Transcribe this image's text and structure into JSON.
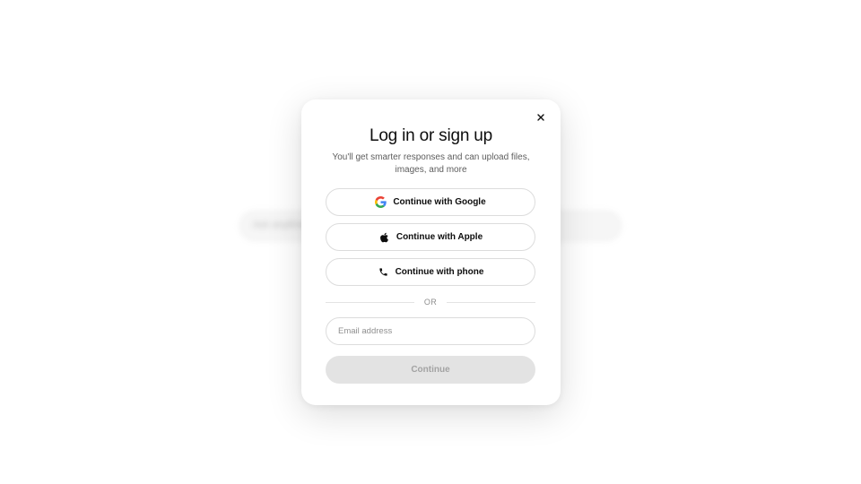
{
  "background": {
    "search_placeholder": "Ask anything"
  },
  "modal": {
    "close_icon": "close-icon",
    "title": "Log in or sign up",
    "subtitle": "You'll get smarter responses and can upload files, images, and more",
    "buttons": {
      "google": {
        "label": "Continue with Google",
        "icon": "google-icon"
      },
      "apple": {
        "label": "Continue with Apple",
        "icon": "apple-icon"
      },
      "phone": {
        "label": "Continue with phone",
        "icon": "phone-icon"
      }
    },
    "divider_text": "OR",
    "email": {
      "placeholder": "Email address",
      "value": ""
    },
    "continue_label": "Continue",
    "continue_disabled": true
  },
  "colors": {
    "text_primary": "#0d0d0d",
    "text_secondary": "#5d5d5d",
    "border": "#dcdcdc",
    "disabled_bg": "#e3e3e3",
    "disabled_text": "#a3a3a3"
  }
}
